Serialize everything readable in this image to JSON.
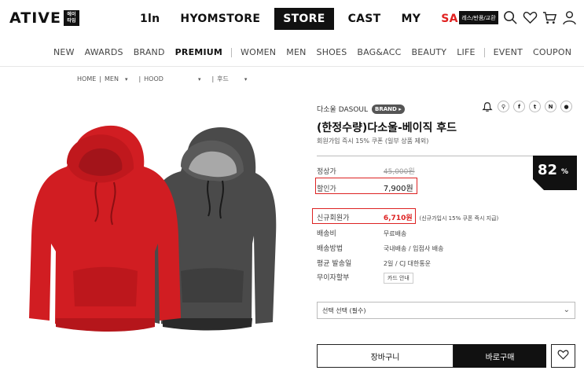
{
  "header": {
    "logo_text": "ATIVE",
    "logo_box_text": "에이\n타임",
    "nav": [
      "1ln",
      "HYOMSTORE",
      "STORE",
      "CAST",
      "MY",
      "SALE"
    ],
    "search_chip": "레스/반품/교환"
  },
  "categories": [
    "NEW",
    "AWARDS",
    "BRAND",
    "PREMIUM",
    "WOMEN",
    "MEN",
    "SHOES",
    "BAG&ACC",
    "BEAUTY",
    "LIFE",
    "EVENT",
    "COUPON"
  ],
  "breadcrumb": [
    "HOME",
    "MEN",
    "HOOD",
    "후드"
  ],
  "product": {
    "brand": "다소울 DASOUL",
    "brand_badge": "BRAND ▸",
    "title": "(한정수량)다소울-베이직 후드",
    "subtitle": "회원가입 즉시 15% 쿠폰 (일부 상품 제외)",
    "discount_percent": "82",
    "percent_sign": "%",
    "rows": {
      "regular_label": "정상가",
      "regular_value": "45,000원",
      "sale_label": "할인가",
      "sale_value": "7,900원",
      "member_label": "신규회원가",
      "member_value": "6,710원",
      "member_note": "(신규가입시 15% 쿠폰 즉시 지급)",
      "shipping_label": "배송비",
      "shipping_value": "무료배송",
      "method_label": "배송방법",
      "method_value": "국내배송 / 입점사 배송",
      "avg_label": "평균 발송일",
      "avg_value": "2일 / CJ 대한통운",
      "installment_label": "무이자할부",
      "installment_value": "카드 안내"
    },
    "option_select": "선택 선택 (필수)",
    "cart_label": "장바구니",
    "buy_label": "바로구매"
  },
  "share_icons": [
    "alarm-icon",
    "link-icon",
    "facebook-icon",
    "twitter-icon",
    "naver-icon",
    "kakao-icon"
  ],
  "share_labels": [
    "⚲",
    "f",
    "t",
    "N",
    "●"
  ],
  "colors": {
    "accent": "#111111",
    "sale": "#e0201f",
    "highlight_box": "#d22222"
  }
}
